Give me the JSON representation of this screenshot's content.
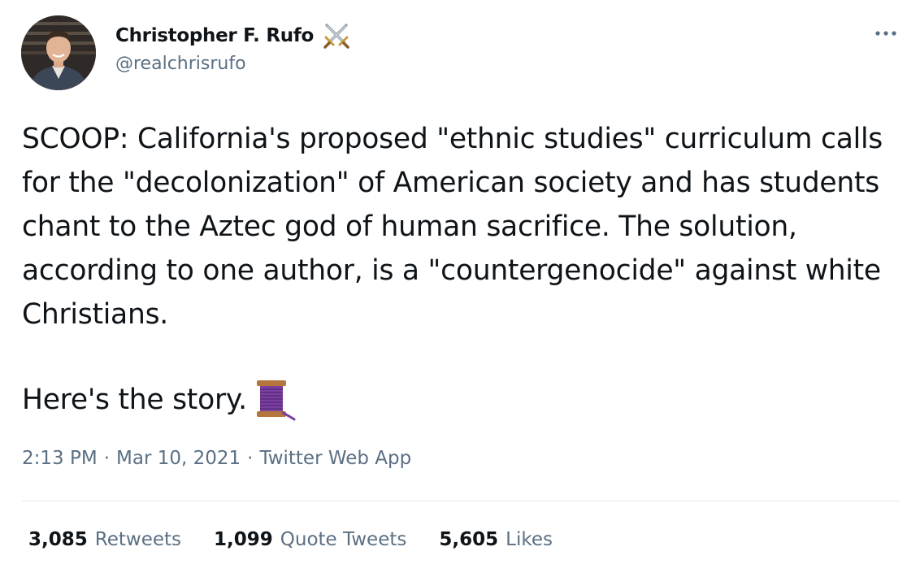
{
  "author": {
    "display_name": "Christopher F. Rufo",
    "handle": "@realchrisrufo",
    "name_emoji": "crossed-swords-icon"
  },
  "tweet": {
    "text": "SCOOP: California's proposed \"ethnic studies\" curriculum calls for the \"decolonization\" of American society and has students chant to the Aztec god of human sacrifice. The solution, according to one author, is a \"countergenocide\" against white Christians.",
    "closing_line": "Here's the story.",
    "closing_emoji": "thread-spool-icon"
  },
  "meta": {
    "time": "2:13 PM",
    "date": "Mar 10, 2021",
    "source": "Twitter Web App",
    "separator": "·"
  },
  "stats": [
    {
      "count": "3,085",
      "label": "Retweets"
    },
    {
      "count": "1,099",
      "label": "Quote Tweets"
    },
    {
      "count": "5,605",
      "label": "Likes"
    }
  ],
  "colors": {
    "text_primary": "#0f1419",
    "text_secondary": "#5b7083",
    "divider": "#e1e8ed",
    "thread_purple": "#7b3fa0"
  }
}
